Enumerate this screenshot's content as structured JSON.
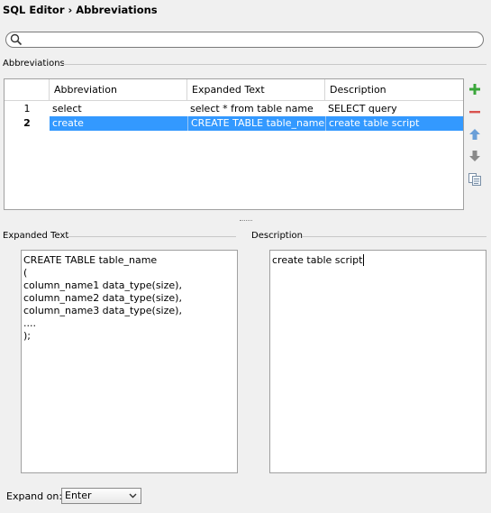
{
  "breadcrumb": {
    "parent": "SQL Editor",
    "separator": "›",
    "current": "Abbreviations"
  },
  "search": {
    "value": "",
    "placeholder": ""
  },
  "abbreviations_group": {
    "label": "Abbreviations"
  },
  "table": {
    "columns": [
      "",
      "Abbreviation",
      "Expanded Text",
      "Description"
    ],
    "rows": [
      {
        "num": "1",
        "abbreviation": "select",
        "expanded": "select * from table name",
        "description": "SELECT query"
      },
      {
        "num": "2",
        "abbreviation": "create",
        "expanded": "CREATE TABLE table_name(…",
        "description": "create table script"
      }
    ],
    "selected_row": 2
  },
  "side_buttons": {
    "add": "add-icon",
    "remove": "remove-icon",
    "up": "move-up-icon",
    "down": "move-down-icon",
    "copy": "copy-icon"
  },
  "expanded_text": {
    "label": "Expanded Text",
    "lines": [
      "CREATE TABLE table_name",
      "(",
      "column_name1 data_type(size),",
      "column_name2 data_type(size),",
      "column_name3 data_type(size),",
      "....",
      ");"
    ]
  },
  "description": {
    "label": "Description",
    "value": "create table script"
  },
  "expand_on": {
    "label": "Expand on:",
    "value": "Enter"
  },
  "colors": {
    "selection": "#3399ff",
    "add": "#3aa63a",
    "remove": "#d9534f",
    "arrows": "#6a9fd8"
  }
}
